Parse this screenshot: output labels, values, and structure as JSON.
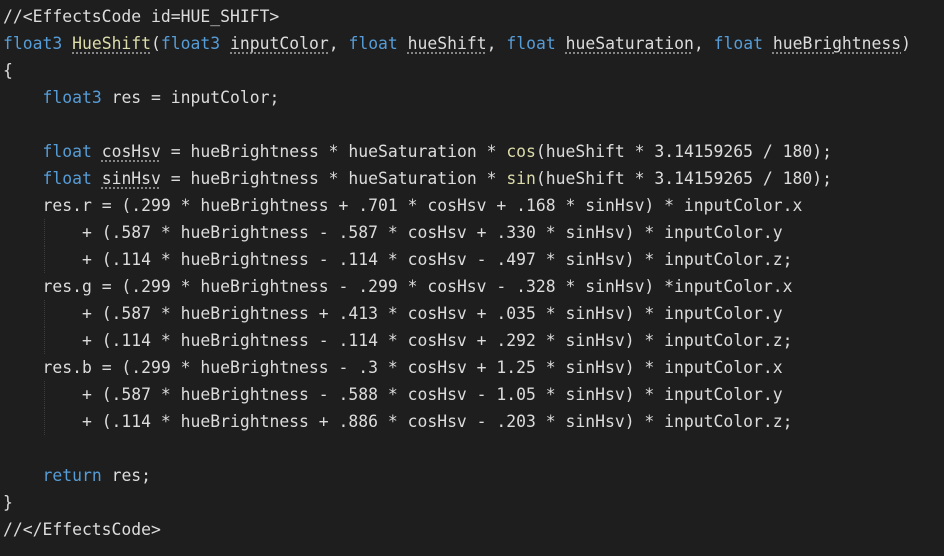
{
  "editor": {
    "background": "#1e1e1e",
    "colors": {
      "keyword": "#569cd6",
      "function": "#dcdcaa",
      "text": "#dcdcdc"
    },
    "lines": [
      {
        "indent": "",
        "tokens": [
          {
            "t": "//<EffectsCode id=HUE_SHIFT>",
            "c": "cm"
          }
        ]
      },
      {
        "indent": "",
        "tokens": [
          {
            "t": "float3",
            "c": "kw"
          },
          {
            "t": " ",
            "c": "tx"
          },
          {
            "t": "HueShift",
            "c": "fn",
            "u": true
          },
          {
            "t": "(",
            "c": "tx"
          },
          {
            "t": "float3",
            "c": "kw"
          },
          {
            "t": " ",
            "c": "tx"
          },
          {
            "t": "inputColor",
            "c": "tx",
            "u": true
          },
          {
            "t": ", ",
            "c": "tx"
          },
          {
            "t": "float",
            "c": "kw"
          },
          {
            "t": " ",
            "c": "tx"
          },
          {
            "t": "hueShift",
            "c": "tx",
            "u": true
          },
          {
            "t": ", ",
            "c": "tx"
          },
          {
            "t": "float",
            "c": "kw"
          },
          {
            "t": " ",
            "c": "tx"
          },
          {
            "t": "hueSaturation",
            "c": "tx",
            "u": true
          },
          {
            "t": ", ",
            "c": "tx"
          },
          {
            "t": "float",
            "c": "kw"
          },
          {
            "t": " ",
            "c": "tx"
          },
          {
            "t": "hueBrightness",
            "c": "tx",
            "u": true
          },
          {
            "t": ")",
            "c": "tx"
          }
        ]
      },
      {
        "indent": "",
        "tokens": [
          {
            "t": "{",
            "c": "tx"
          }
        ]
      },
      {
        "indent": "    ",
        "tokens": [
          {
            "t": "float3",
            "c": "kw"
          },
          {
            "t": " res = inputColor;",
            "c": "tx"
          }
        ]
      },
      {
        "indent": "",
        "tokens": []
      },
      {
        "indent": "    ",
        "tokens": [
          {
            "t": "float",
            "c": "kw"
          },
          {
            "t": " ",
            "c": "tx"
          },
          {
            "t": "cosHsv",
            "c": "tx",
            "u": true
          },
          {
            "t": " = hueBrightness * hueSaturation * ",
            "c": "tx"
          },
          {
            "t": "cos",
            "c": "fn"
          },
          {
            "t": "(hueShift * 3.14159265 / 180);",
            "c": "tx"
          }
        ]
      },
      {
        "indent": "    ",
        "tokens": [
          {
            "t": "float",
            "c": "kw"
          },
          {
            "t": " ",
            "c": "tx"
          },
          {
            "t": "sinHsv",
            "c": "tx",
            "u": true
          },
          {
            "t": " = hueBrightness * hueSaturation * ",
            "c": "tx"
          },
          {
            "t": "sin",
            "c": "fn"
          },
          {
            "t": "(hueShift * 3.14159265 / 180);",
            "c": "tx"
          }
        ]
      },
      {
        "indent": "    ",
        "tokens": [
          {
            "t": "res.r = (.299 * hueBrightness + .701 * cosHsv + .168 * sinHsv) * inputColor.x",
            "c": "tx"
          }
        ]
      },
      {
        "indent": "        ",
        "tokens": [
          {
            "t": "+ (.587 * hueBrightness - .587 * cosHsv + .330 * sinHsv) * inputColor.y",
            "c": "tx"
          }
        ]
      },
      {
        "indent": "        ",
        "tokens": [
          {
            "t": "+ (.114 * hueBrightness - .114 * cosHsv - .497 * sinHsv) * inputColor.z;",
            "c": "tx"
          }
        ]
      },
      {
        "indent": "    ",
        "tokens": [
          {
            "t": "res.g = (.299 * hueBrightness - .299 * cosHsv - .328 * sinHsv) *inputColor.x",
            "c": "tx"
          }
        ]
      },
      {
        "indent": "        ",
        "tokens": [
          {
            "t": "+ (.587 * hueBrightness + .413 * cosHsv + .035 * sinHsv) * inputColor.y",
            "c": "tx"
          }
        ]
      },
      {
        "indent": "        ",
        "tokens": [
          {
            "t": "+ (.114 * hueBrightness - .114 * cosHsv + .292 * sinHsv) * inputColor.z;",
            "c": "tx"
          }
        ]
      },
      {
        "indent": "    ",
        "tokens": [
          {
            "t": "res.b = (.299 * hueBrightness - .3 * cosHsv + 1.25 * sinHsv) * inputColor.x",
            "c": "tx"
          }
        ]
      },
      {
        "indent": "        ",
        "tokens": [
          {
            "t": "+ (.587 * hueBrightness - .588 * cosHsv - 1.05 * sinHsv) * inputColor.y",
            "c": "tx"
          }
        ]
      },
      {
        "indent": "        ",
        "tokens": [
          {
            "t": "+ (.114 * hueBrightness + .886 * cosHsv - .203 * sinHsv) * inputColor.z;",
            "c": "tx"
          }
        ]
      },
      {
        "indent": "",
        "tokens": []
      },
      {
        "indent": "    ",
        "tokens": [
          {
            "t": "return",
            "c": "kw"
          },
          {
            "t": " res;",
            "c": "tx"
          }
        ]
      },
      {
        "indent": "",
        "tokens": [
          {
            "t": "}",
            "c": "tx"
          }
        ]
      },
      {
        "indent": "",
        "tokens": [
          {
            "t": "//</EffectsCode>",
            "c": "cm"
          }
        ]
      }
    ]
  }
}
